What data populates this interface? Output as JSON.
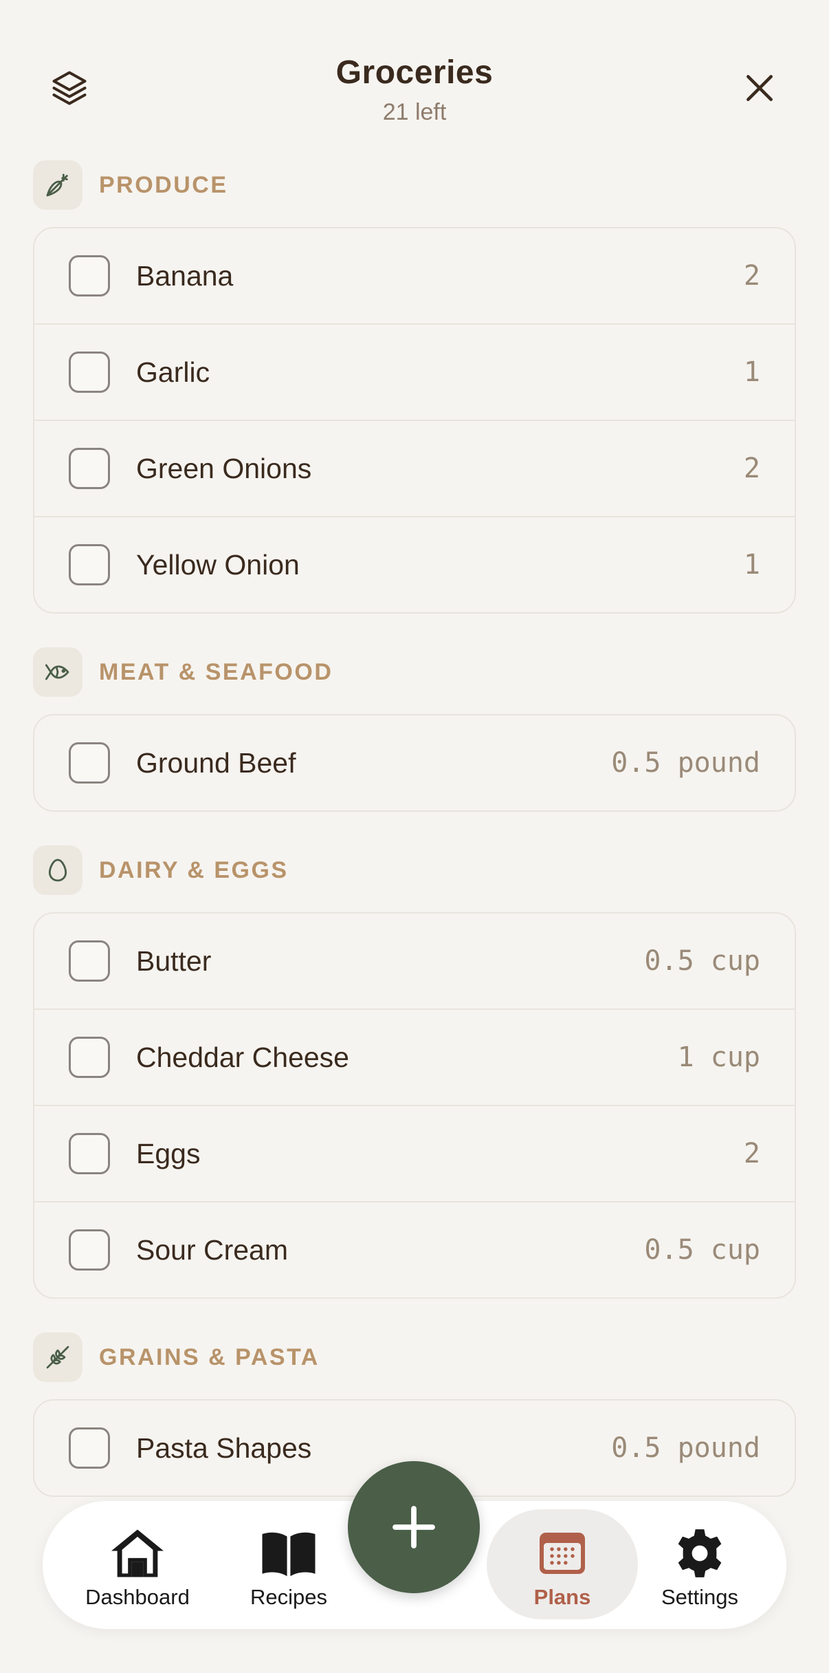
{
  "header": {
    "title": "Groceries",
    "subtitle": "21 left",
    "left_icon": "layers-icon",
    "right_icon": "close-icon"
  },
  "sections": [
    {
      "title": "PRODUCE",
      "icon": "carrot-icon",
      "items": [
        {
          "name": "Banana",
          "qty": "2"
        },
        {
          "name": "Garlic",
          "qty": "1"
        },
        {
          "name": "Green Onions",
          "qty": "2"
        },
        {
          "name": "Yellow Onion",
          "qty": "1"
        }
      ]
    },
    {
      "title": "MEAT & SEAFOOD",
      "icon": "fish-icon",
      "items": [
        {
          "name": "Ground Beef",
          "qty": "0.5 pound"
        }
      ]
    },
    {
      "title": "DAIRY & EGGS",
      "icon": "egg-icon",
      "items": [
        {
          "name": "Butter",
          "qty": "0.5 cup"
        },
        {
          "name": "Cheddar Cheese",
          "qty": "1 cup"
        },
        {
          "name": "Eggs",
          "qty": "2"
        },
        {
          "name": "Sour Cream",
          "qty": "0.5 cup"
        }
      ]
    },
    {
      "title": "GRAINS & PASTA",
      "icon": "wheat-icon",
      "items": [
        {
          "name": "Pasta Shapes",
          "qty": "0.5 pound"
        }
      ]
    }
  ],
  "nav": {
    "tabs": [
      {
        "label": "Dashboard",
        "icon": "home-icon"
      },
      {
        "label": "Recipes",
        "icon": "book-icon"
      },
      {
        "label": "Plans",
        "icon": "calendar-icon",
        "active": true
      },
      {
        "label": "Settings",
        "icon": "gear-icon"
      }
    ],
    "fab_icon": "plus-icon"
  },
  "colors": {
    "background": "#f6f4f0",
    "section_title": "#b8936a",
    "accent_green": "#4a5e48",
    "active_tab": "#b0604a",
    "text": "#3a2a1e",
    "muted": "#9a8a78"
  }
}
